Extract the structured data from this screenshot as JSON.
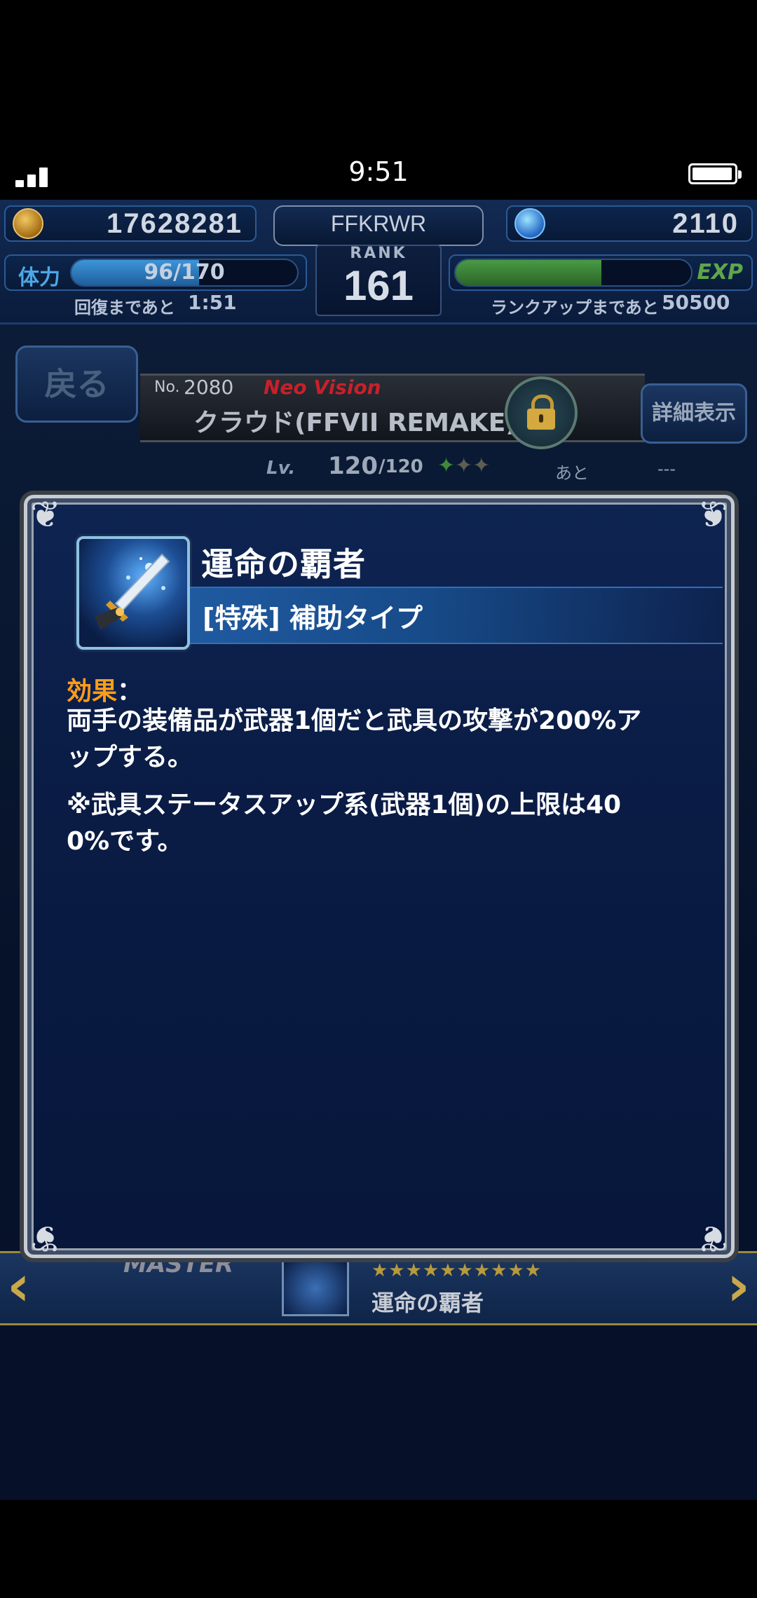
{
  "status_bar": {
    "time": "9:51",
    "signal_bars": 3,
    "battery_level": 0.85
  },
  "header": {
    "gil": "17628281",
    "player_name": "FFKRWR",
    "gems": "2110",
    "rank_label": "RANK",
    "rank": "161",
    "stamina_label": "体力",
    "stamina": "96/170",
    "stamina_fraction": 0.565,
    "recovery_label": "回復まであと",
    "recovery_time": "1:51",
    "exp_label": "EXP",
    "exp_fraction": 0.62,
    "rankup_label": "ランクアップまであと",
    "rankup_remaining": "50500"
  },
  "character": {
    "back_label": "戻る",
    "number_prefix": "No.",
    "number": "2080",
    "tag": "Neo Vision",
    "name": "クラウド(FFVII REMAKE)",
    "details_label": "詳細表示",
    "level_label": "Lv.",
    "level": "120",
    "level_max": "/120",
    "remaining_label": "あと",
    "remaining_value": "---"
  },
  "modal": {
    "skill_name": "運命の覇者",
    "skill_type": "[特殊] 補助タイプ",
    "effect_label": "効果",
    "effect_colon": "：",
    "effect_lines": [
      "両手の装備品が武器1個だと武具の攻撃が200%ア",
      "ップする。"
    ],
    "note_lines": [
      "※武具ステータスアップ系(武器1個)の上限は40",
      "0%です。"
    ]
  },
  "bottom_strip": {
    "master_label": "MASTER",
    "stars": "★★★★★★★★★★",
    "skill_name": "運命の覇者"
  },
  "colors": {
    "accent_orange": "#ff9c1a",
    "stamina_blue": "#2f7fc4",
    "exp_green": "#3f8a3a",
    "neo_vision_red": "#c8202a"
  }
}
